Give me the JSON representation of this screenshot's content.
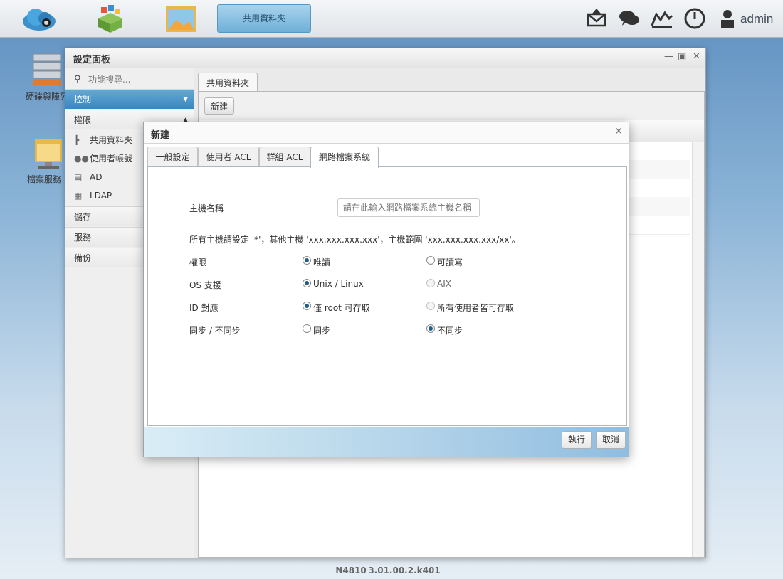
{
  "topbar": {
    "task_label": "共用資料夾",
    "user": "admin",
    "icons": [
      "cloud-icon",
      "apps-icon",
      "folder-icon",
      "mail-icon",
      "chat-icon",
      "monitor-icon",
      "power-icon",
      "user-icon"
    ]
  },
  "desktop": {
    "icons": [
      {
        "label": "硬碟與陣列",
        "icon": "disk-icon"
      },
      {
        "label": "檔案服務",
        "icon": "file-server-icon"
      }
    ]
  },
  "window": {
    "title": "設定面板",
    "search_placeholder": "功能搜尋...",
    "categories": {
      "control": "控制",
      "permission": "權限",
      "storage": "儲存",
      "service": "服務",
      "backup": "備份"
    },
    "sub_items": [
      {
        "label": "共用資料夾",
        "icon": "tree-icon"
      },
      {
        "label": "使用者帳號",
        "icon": "users-icon"
      },
      {
        "label": "AD",
        "icon": "ad-icon"
      },
      {
        "label": "LDAP",
        "icon": "ldap-icon"
      }
    ],
    "tab": "共用資料夾",
    "new_button": "新建"
  },
  "dialog": {
    "title": "新建",
    "tabs": [
      "一般設定",
      "使用者 ACL",
      "群組 ACL",
      "網路檔案系統"
    ],
    "host_label": "主機名稱",
    "host_placeholder": "請在此輸入網路檔案系統主機名稱",
    "hint": "所有主機請設定 '*'，其他主機 'xxx.xxx.xxx.xxx'，主機範圍 'xxx.xxx.xxx.xxx/xx'。",
    "rows": [
      {
        "label": "權限",
        "opt1": "唯讀",
        "opt2": "可讀寫",
        "selected": 1
      },
      {
        "label": "OS 支援",
        "opt1": "Unix / Linux",
        "opt2": "AIX",
        "selected": 1
      },
      {
        "label": "ID 對應",
        "opt1": "僅 root 可存取",
        "opt2": "所有使用者皆可存取",
        "selected": 1
      },
      {
        "label": "同步 / 不同步",
        "opt1": "同步",
        "opt2": "不同步",
        "selected": 2
      }
    ],
    "ok": "執行",
    "cancel": "取消"
  },
  "footer": {
    "model": "N4810",
    "version": "3.01.00.2.k401"
  }
}
